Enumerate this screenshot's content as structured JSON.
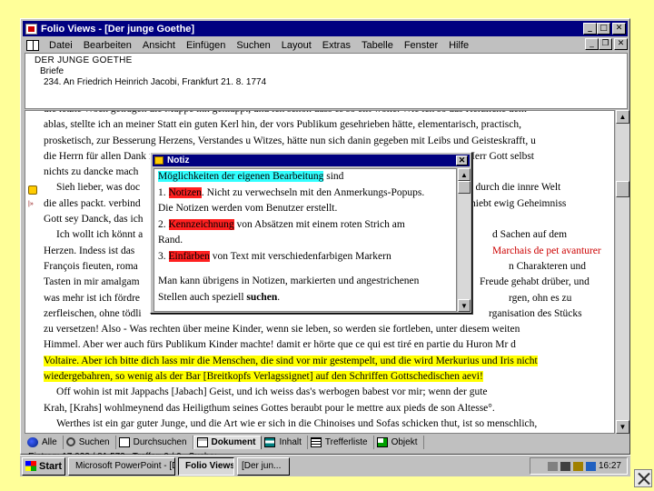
{
  "window": {
    "title": "Folio Views - [Der junge Goethe]"
  },
  "menu": [
    "Datei",
    "Bearbeiten",
    "Ansicht",
    "Einfügen",
    "Suchen",
    "Layout",
    "Extras",
    "Tabelle",
    "Fenster",
    "Hilfe"
  ],
  "header": {
    "line1": "DER JUNGE GOETHE",
    "line2": "Briefe",
    "line3": "234. An Friedrich Heinrich Jacobi, Frankfurt 21. 8. 1774"
  },
  "document": {
    "lines": [
      "die letzte Woch getragen die Mappe ihn geklappt, und ich schon dass es so eilt wolle. Wie ich so das Herzliche dem",
      "ablas, stellte ich an meiner Statt ein guten Kerl hin, der vors Publikum gesehrieben hätte, elementarisch, practisch,",
      "prosketisch, zur Besserung Herzens, Verstandes u Witzes, hätte nun sich danin gegeben mit Leibs und Geisteskrafft, u",
      "die Herrn für allen Dank für dens unter der Erwartung. Erwartung den Narren den wie besammlissen Herr Gott selbst",
      "nichts zu dancke mach",
      "Sieh lieber, was doc",
      "die alles packt. verbind",
      "Gott sey Danck, das ich",
      "Ich wollt ich könnt a",
      "Herzen. Indess ist das",
      "François fieuten, roma",
      "Tasten in mir amalgam",
      "was mehr ist ich fördre",
      "zerfleischen, ohne tödli",
      "zu versetzen! Also - Was rechten über meine Kinder, wenn sie leben, so werden sie fortleben, unter diesem weiten",
      "Himmel. Aber wer auch fürs Publikum Kinder machte! damit er hörte que ce qui est tiré en partie du Huron Mr d",
      "Voltaire. Aber ich bitte dich lass mir die Menschen, die sind vor mir gestempelt, und die wird Merkurius und Iris nicht",
      "wiedergebahren, so wenig als der Bar [Breitkopfs Verlagssignet] auf den Schriffen Gottschedischen aevi!",
      "Off wohin ist mit Jappachs [Jabach] Geist, und ich weiss das's werbogen babest vor mir; wenn der gute",
      "Krah, [Krahs] wohlmeynend das Heiligthum seines Gottes beraubt pour le mettre aux pieds de son Altesse°.",
      "Werthes ist ein gar guter Junge, und die Art wie er sich in die Chinoises und Sofas schicken thut, ist so menschlich,"
    ],
    "right_fragments": [
      "nich, durch die innre Welt",
      "hiebt ewig Geheimniss",
      "d Sachen auf dem",
      "Marchais de pet avanturer",
      "n Charakteren und",
      "Freude gehabt drüber, und",
      "rgen, ohn es zu",
      "rganisation des Stücks"
    ]
  },
  "notiz": {
    "title": "Notiz",
    "line1_hl": "Möglichkeiten der eigenen Bearbeitung",
    "line1_rest": " sind",
    "line2_pre": "1. ",
    "line2_hl": "Notizen",
    "line2_rest": ". Nicht zu verwechseln mit den Anmerkungs-Popups.",
    "line3": "Die Notizen werden vom Benutzer erstellt.",
    "line4_pre": "2. ",
    "line4_hl": "Kennzeichnung",
    "line4_rest": " von Absätzen mit einem roten Strich am",
    "line5": "Rand.",
    "line6_pre": "3. ",
    "line6_hl": "Einfärben",
    "line6_rest": " von Text mit verschiedenfarbigen Markern",
    "line7": "Man kann übrigens in Notizen, markierten und angestrichenen",
    "line8_pre": "Stellen auch speziell ",
    "line8_strong": "suchen",
    "line8_post": "."
  },
  "tabs": [
    "Alle",
    "Suchen",
    "Durchsuchen",
    "Dokument",
    "Inhalt",
    "Trefferliste",
    "Objekt"
  ],
  "status": {
    "entry": "Eintrag: 17.032 / 81.573",
    "hits": "Treffer: 0 / 0",
    "search": "Suche:"
  },
  "taskbar": {
    "start": "Start",
    "items": [
      "Microsoft PowerPoint - [D...",
      "Folio Views",
      "[Der jun..."
    ],
    "clock": "16:27"
  },
  "colors": {
    "desktop": "#ffff99",
    "titlebar": "#000080",
    "highlight_yellow": "#ffff00",
    "highlight_cyan": "#33ffff",
    "highlight_red": "#ff2020"
  }
}
